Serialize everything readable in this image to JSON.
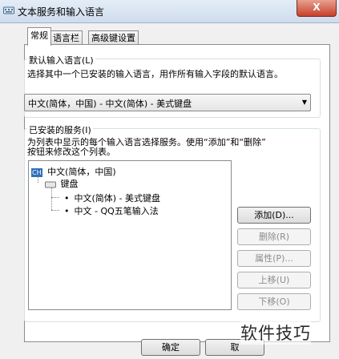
{
  "window": {
    "title": "文本服务和输入语言",
    "close_label": "X",
    "icons": {
      "title": "keyboard-icon",
      "close": "close-icon"
    }
  },
  "tabs": [
    {
      "label": "常规",
      "active": true
    },
    {
      "label": "语言栏",
      "active": false
    },
    {
      "label": "高级键设置",
      "active": false
    }
  ],
  "default_language": {
    "group_label": "默认输入语言(L)",
    "description": "选择其中一个已安装的输入语言，用作所有输入字段的默认语言。",
    "selected": "中文(简体，中国) - 中文(简体) - 美式键盘"
  },
  "installed_services": {
    "group_label": "已安装的服务(I)",
    "description_line1": "为列表中显示的每个输入语言选择服务。使用“添加”和“删除”",
    "description_line2": "按钮来修改这个列表。",
    "tree": {
      "language_badge": "CH",
      "language": "中文(简体，中国)",
      "category": "键盘",
      "items": [
        "中文(简体) - 美式键盘",
        "中文 - QQ五笔输入法"
      ]
    },
    "buttons": {
      "add": "添加(D)...",
      "remove": "删除(R)",
      "properties": "属性(P)...",
      "move_up": "上移(U)",
      "move_down": "下移(O)"
    }
  },
  "footer": {
    "ok": "确定",
    "cancel": "取"
  },
  "watermark": "软件技巧"
}
